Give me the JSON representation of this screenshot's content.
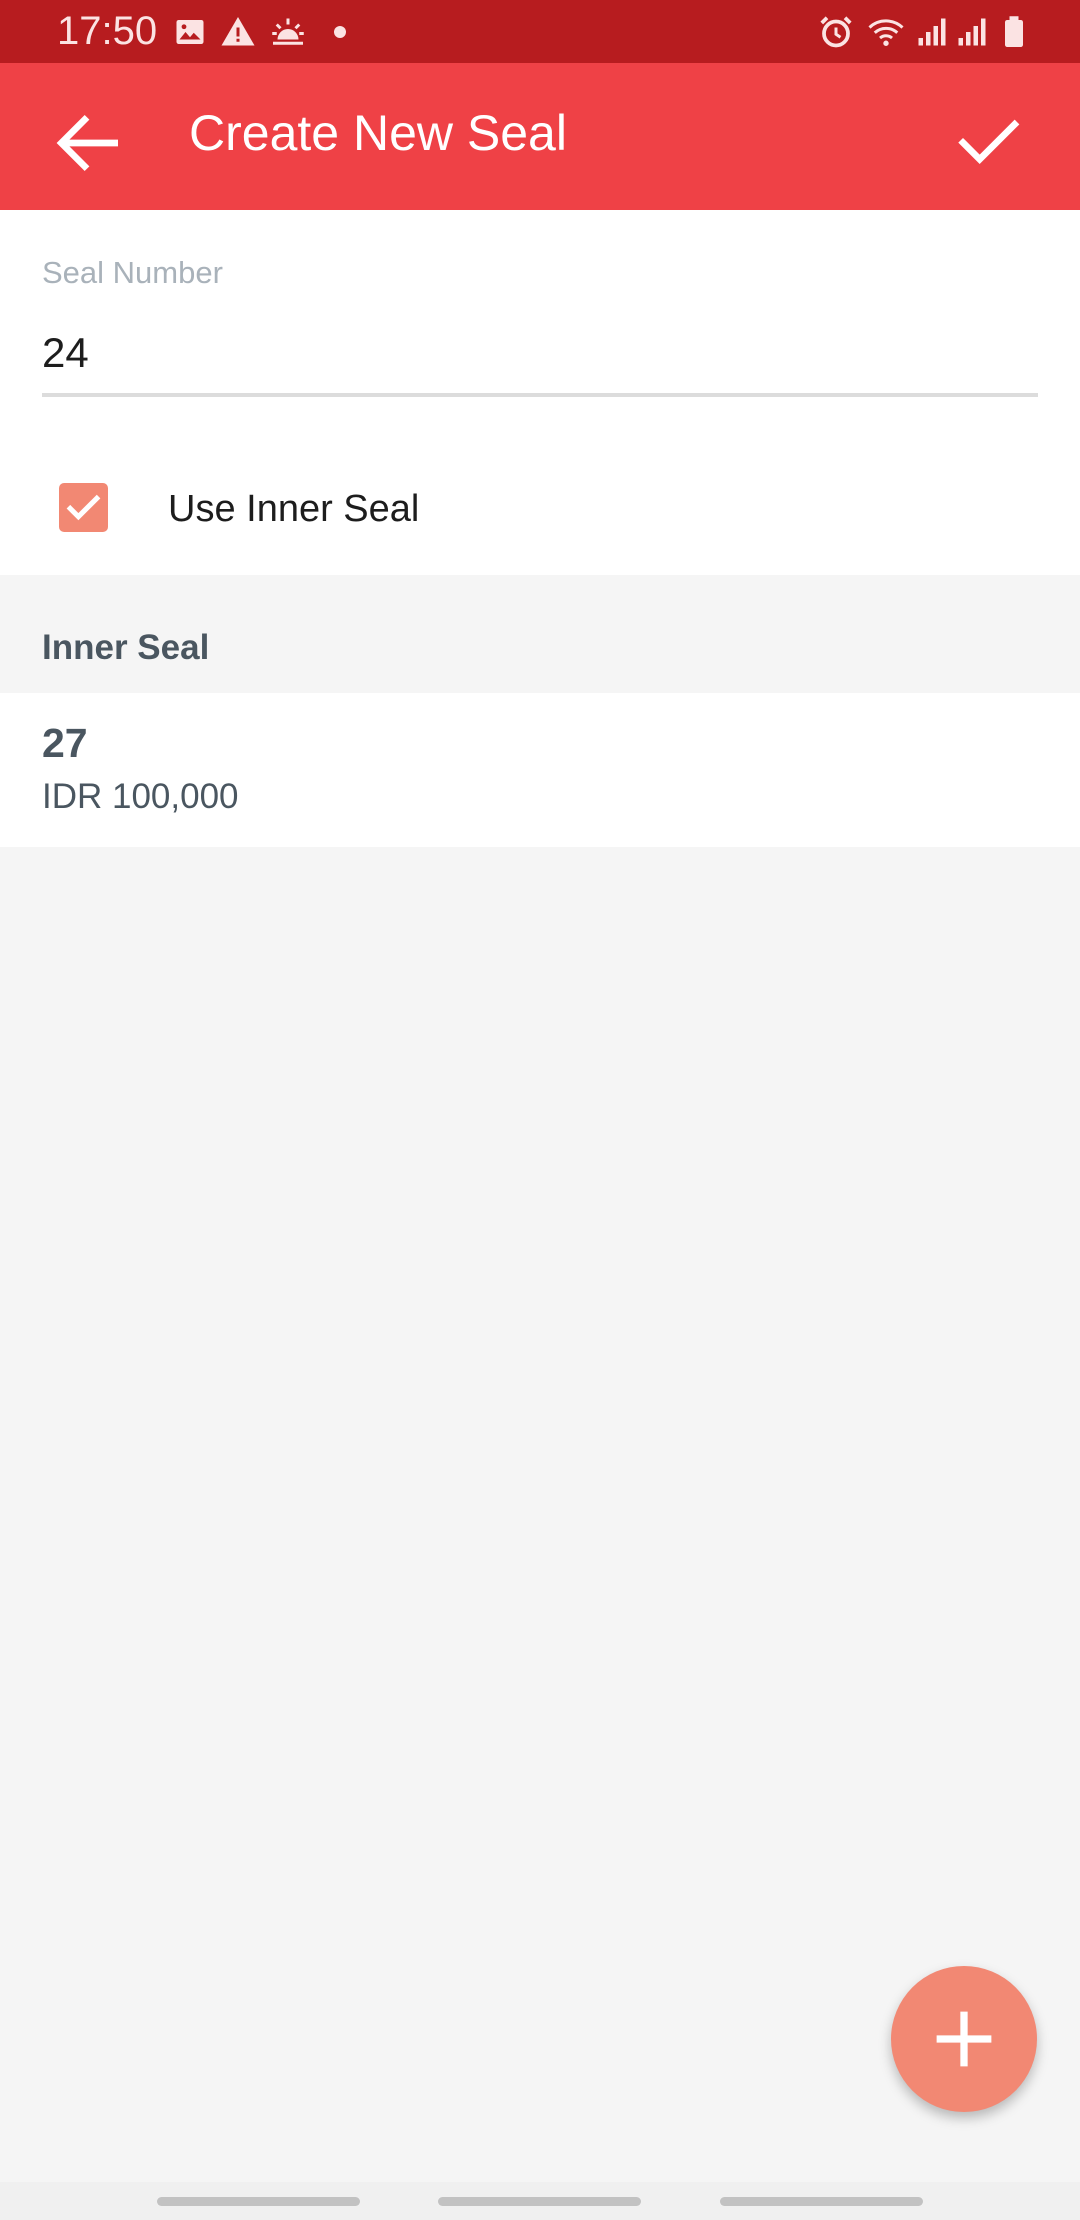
{
  "status_bar": {
    "time": "17:50",
    "left_icons": [
      "image-icon",
      "warning-icon",
      "sunrise-icon",
      "dot-icon"
    ],
    "right_icons": [
      "alarm-icon",
      "wifi-icon",
      "signal-icon",
      "signal-icon",
      "battery-icon"
    ]
  },
  "app_bar": {
    "title": "Create New Seal",
    "back_icon": "arrow-left-icon",
    "confirm_icon": "check-icon",
    "color": "#ef4146"
  },
  "form": {
    "seal_number_label": "Seal Number",
    "seal_number_value": "24",
    "use_inner_seal_label": "Use Inner Seal",
    "use_inner_seal_checked": true
  },
  "inner_seal_section": {
    "header": "Inner Seal",
    "items": [
      {
        "number": "27",
        "amount": "IDR 100,000"
      }
    ]
  },
  "fab": {
    "icon": "plus-icon",
    "color": "#f28873"
  }
}
